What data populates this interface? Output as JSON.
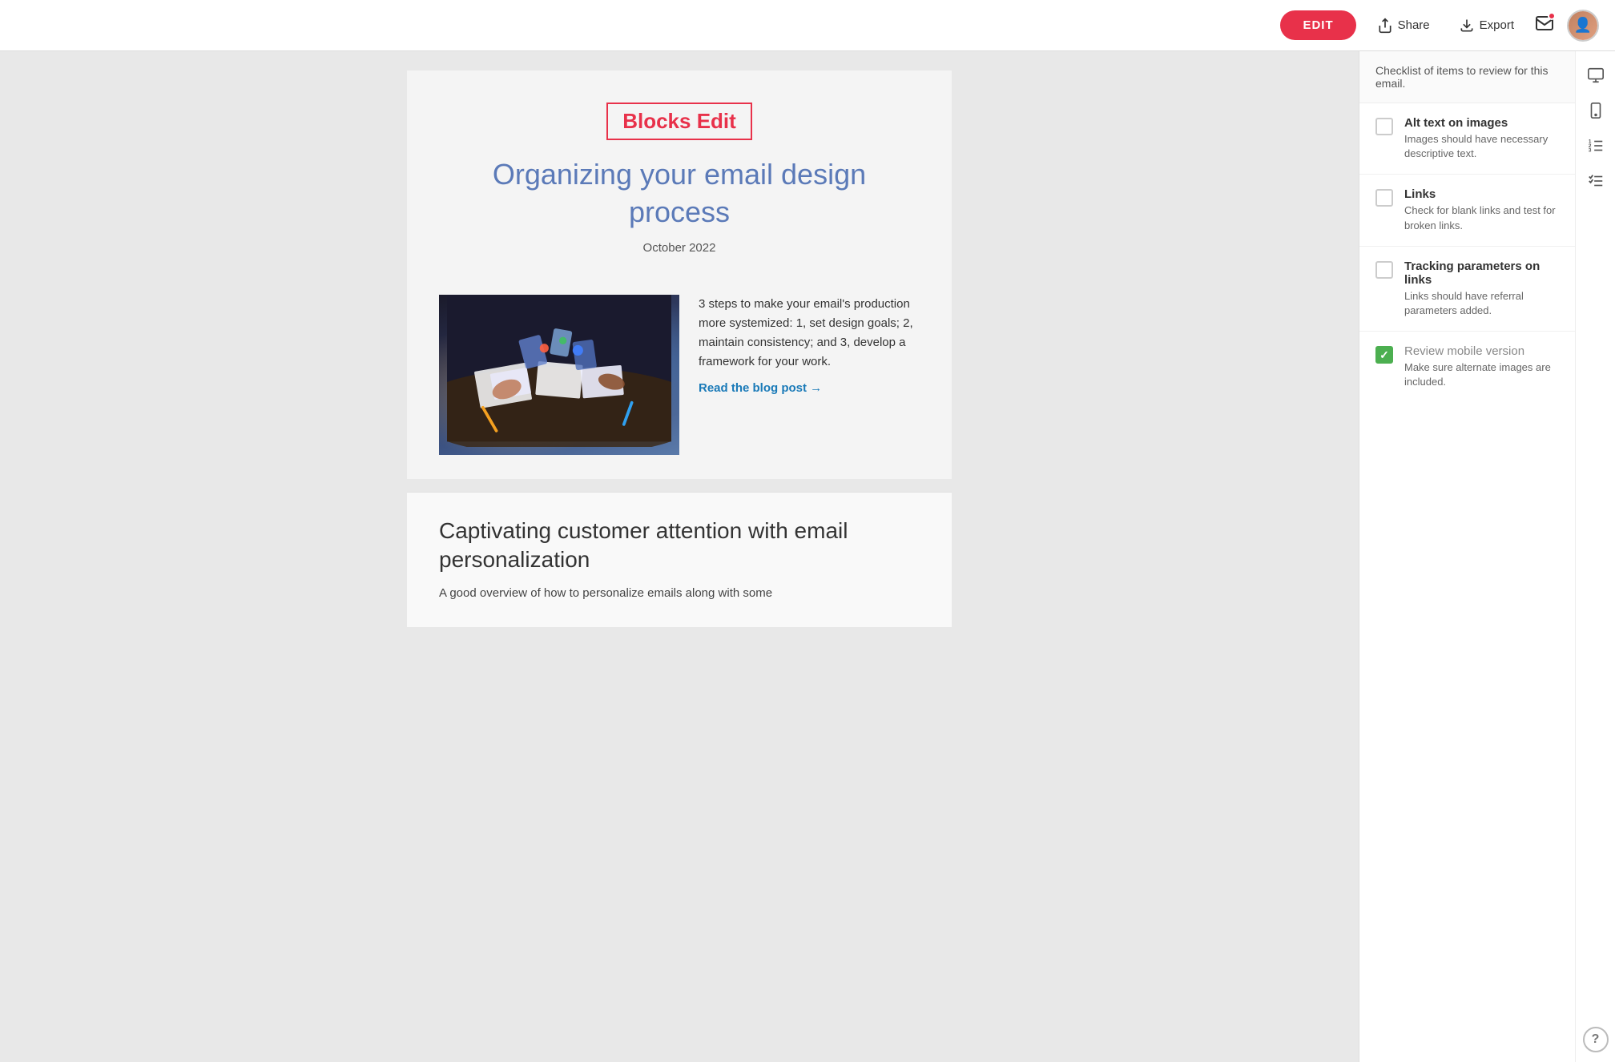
{
  "topbar": {
    "edit_label": "EDIT",
    "share_label": "Share",
    "export_label": "Export"
  },
  "email": {
    "brand_label": "Blocks Edit",
    "title": "Organizing your email design process",
    "date": "October 2022",
    "featured_desc": "3 steps to make your email's production more systemized: 1, set design goals; 2, maintain consistency; and 3, develop a framework for your work.",
    "read_link": "Read the blog post →",
    "second_title": "Captivating customer attention with email personalization",
    "second_desc": "A good overview of how to personalize emails along with some"
  },
  "checklist": {
    "header": "Checklist of items to review for this email.",
    "items": [
      {
        "title": "Alt text on images",
        "desc": "Images should have necessary descriptive text.",
        "checked": false
      },
      {
        "title": "Links",
        "desc": "Check for blank links and test for broken links.",
        "checked": false
      },
      {
        "title": "Tracking parameters on links",
        "desc": "Links should have referral parameters added.",
        "checked": false
      },
      {
        "title": "Review mobile version",
        "desc": "Make sure alternate images are included.",
        "checked": true
      }
    ]
  },
  "sidebar": {
    "desktop_icon": "desktop",
    "mobile_icon": "mobile",
    "list1_icon": "list-numbered",
    "list2_icon": "list-check",
    "help_label": "?"
  }
}
